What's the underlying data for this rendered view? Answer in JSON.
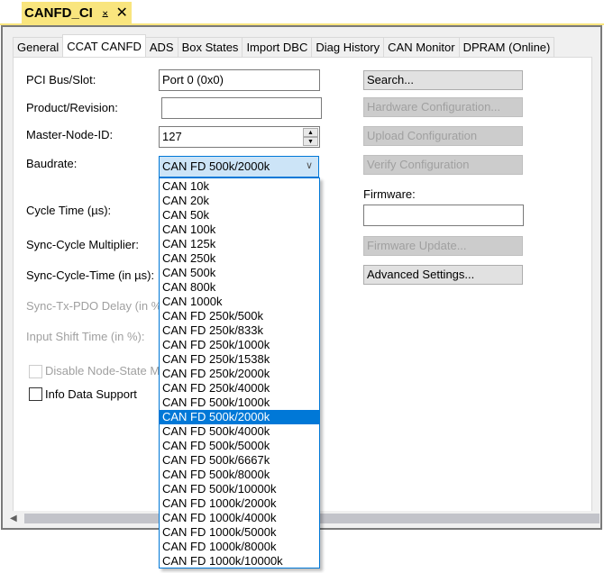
{
  "document_tab": {
    "title": "CANFD_CI",
    "pin_icon": "⨱",
    "close_icon": "✕"
  },
  "tabs": [
    {
      "label": "General",
      "active": false
    },
    {
      "label": "CCAT CANFD",
      "active": true
    },
    {
      "label": "ADS",
      "active": false
    },
    {
      "label": "Box States",
      "active": false
    },
    {
      "label": "Import DBC",
      "active": false
    },
    {
      "label": "Diag History",
      "active": false
    },
    {
      "label": "CAN Monitor",
      "active": false
    },
    {
      "label": "DPRAM (Online)",
      "active": false
    }
  ],
  "form": {
    "pci_bus_slot": {
      "label": "PCI Bus/Slot:",
      "value": "Port 0 (0x0)"
    },
    "product_revision": {
      "label": "Product/Revision:",
      "value": ""
    },
    "master_node_id": {
      "label": "Master-Node-ID:",
      "value": "127",
      "up_icon": "▲",
      "down_icon": "▼"
    },
    "baudrate": {
      "label": "Baudrate:",
      "value": "CAN FD 500k/2000k",
      "chevron_icon": "∨",
      "options": [
        "CAN 10k",
        "CAN 20k",
        "CAN 50k",
        "CAN 100k",
        "CAN 125k",
        "CAN 250k",
        "CAN 500k",
        "CAN 800k",
        "CAN 1000k",
        "CAN FD 250k/500k",
        "CAN FD 250k/833k",
        "CAN FD 250k/1000k",
        "CAN FD 250k/1538k",
        "CAN FD 250k/2000k",
        "CAN FD 250k/4000k",
        "CAN FD 500k/1000k",
        "CAN FD 500k/2000k",
        "CAN FD 500k/4000k",
        "CAN FD 500k/5000k",
        "CAN FD 500k/6667k",
        "CAN FD 500k/8000k",
        "CAN FD 500k/10000k",
        "CAN FD 1000k/2000k",
        "CAN FD 1000k/4000k",
        "CAN FD 1000k/5000k",
        "CAN FD 1000k/8000k",
        "CAN FD 1000k/10000k"
      ],
      "selected_index": 16
    },
    "cycle_time": {
      "label": "Cycle Time (µs):"
    },
    "sync_cycle_multiplier": {
      "label": "Sync-Cycle Multiplier:"
    },
    "sync_cycle_time": {
      "label": "Sync-Cycle-Time (in µs):"
    },
    "sync_tx_pdo_delay": {
      "label": "Sync-Tx-PDO Delay (in %):"
    },
    "input_shift_time": {
      "label": "Input Shift Time (in %):"
    },
    "disable_node_state": {
      "label": "Disable Node-State Modification",
      "checked": false,
      "enabled": false
    },
    "info_data_support": {
      "label": "Info Data Support",
      "checked": false,
      "enabled": true
    }
  },
  "buttons": {
    "search": {
      "label": "Search...",
      "enabled": true
    },
    "hardware_configuration": {
      "label": "Hardware Configuration...",
      "enabled": false
    },
    "upload_configuration": {
      "label": "Upload Configuration",
      "enabled": false
    },
    "verify_configuration": {
      "label": "Verify Configuration",
      "enabled": false
    },
    "firmware_update": {
      "label": "Firmware Update...",
      "enabled": false
    },
    "advanced_settings": {
      "label": "Advanced Settings...",
      "enabled": true
    }
  },
  "firmware": {
    "label": "Firmware:",
    "value": ""
  },
  "scrollbar": {
    "left_arrow_icon": "◀"
  },
  "colors": {
    "doc_tab_bg": "#f9e57e",
    "selection": "#0078d7",
    "combo_focus_bg": "#cce4f7"
  }
}
